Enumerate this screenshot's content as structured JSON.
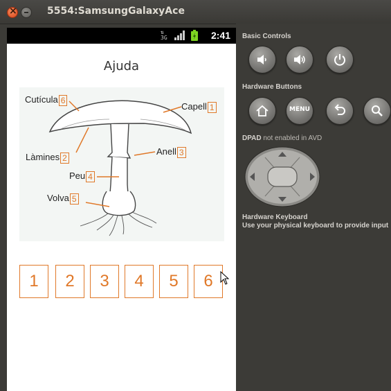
{
  "window": {
    "title": "5554:SamsungGalaxyAce"
  },
  "status_bar": {
    "time": "2:41",
    "data_indicator": "3G"
  },
  "app": {
    "title": "Ajuda"
  },
  "diagram": {
    "labels": [
      {
        "text": "Cutícula",
        "number": "6"
      },
      {
        "text": "Capell",
        "number": "1"
      },
      {
        "text": "Làmines",
        "number": "2"
      },
      {
        "text": "Anell",
        "number": "3"
      },
      {
        "text": "Peu",
        "number": "4"
      },
      {
        "text": "Volva",
        "number": "5"
      }
    ]
  },
  "answer_buttons": [
    "1",
    "2",
    "3",
    "4",
    "5",
    "6"
  ],
  "accent_color": "#e07828",
  "panel": {
    "basic_controls": "Basic Controls",
    "hardware_buttons": "Hardware Buttons",
    "menu_label": "MENU",
    "dpad_title": "DPAD",
    "dpad_note": "not enabled in AVD",
    "keyboard_title": "Hardware Keyboard",
    "keyboard_note": "Use your physical keyboard to provide input"
  },
  "icons": [
    "volume-down-icon",
    "volume-up-icon",
    "power-icon",
    "home-icon",
    "back-icon",
    "search-icon"
  ]
}
